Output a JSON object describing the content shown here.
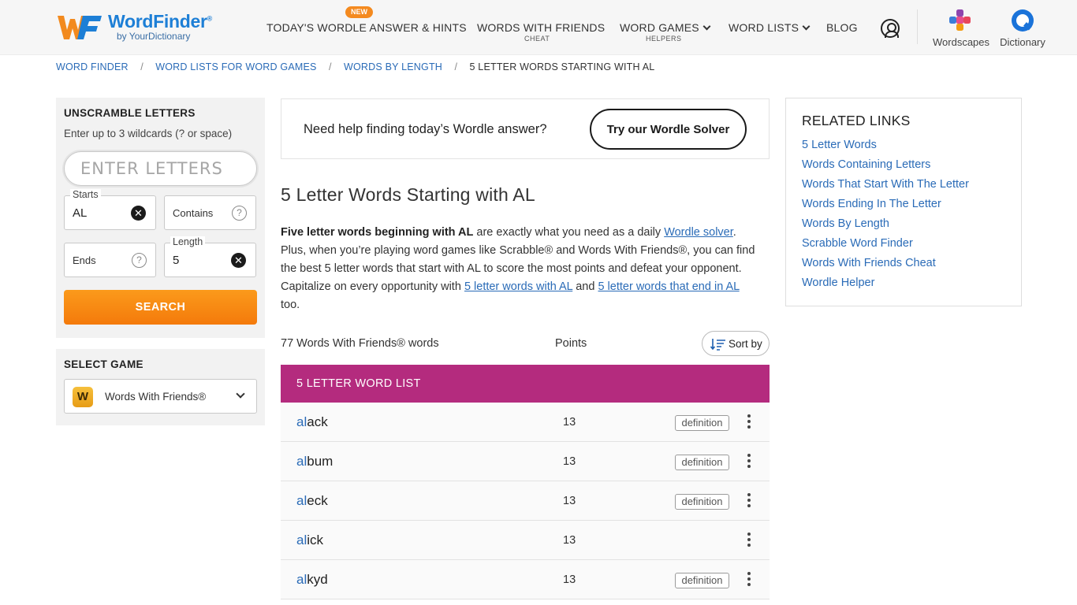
{
  "header": {
    "logo_name": "WordFinder",
    "logo_reg": "®",
    "logo_sub": "by YourDictionary",
    "nav": [
      {
        "label": "TODAY'S WORDLE ANSWER & HINTS",
        "badge": "NEW",
        "sub": ""
      },
      {
        "label": "WORDS WITH FRIENDS",
        "sub": "CHEAT"
      },
      {
        "label": "WORD GAMES",
        "sub": "HELPERS"
      },
      {
        "label": "WORD LISTS",
        "sub": ""
      },
      {
        "label": "BLOG",
        "sub": ""
      }
    ],
    "apps": [
      {
        "label": "Wordscapes",
        "icon": "wordscapes-icon"
      },
      {
        "label": "Dictionary",
        "icon": "dictionary-icon"
      }
    ]
  },
  "breadcrumb": [
    "WORD FINDER",
    "WORD LISTS FOR WORD GAMES",
    "WORDS BY LENGTH",
    "5 LETTER WORDS STARTING WITH AL"
  ],
  "unscramble": {
    "title": "UNSCRAMBLE LETTERS",
    "help": "Enter up to 3 wildcards (? or space)",
    "placeholder": "ENTER LETTERS",
    "starts_label": "Starts",
    "starts_value": "AL",
    "contains_label": "Contains",
    "ends_label": "Ends",
    "length_label": "Length",
    "length_value": "5",
    "search_label": "SEARCH"
  },
  "select_game": {
    "title": "SELECT GAME",
    "logo_letter": "W",
    "selected": "Words With Friends®"
  },
  "promo": {
    "text": "Need help finding today’s Wordle answer?",
    "button": "Try our Wordle Solver"
  },
  "main": {
    "title": "5 Letter Words Starting with AL",
    "intro": {
      "bold": "Five letter words beginning with AL",
      "t1": " are exactly what you need as a daily ",
      "link1": "Wordle solver",
      "t2": ". Plus, when you’re playing word games like Scrabble® and Words With Friends®, you can find the best 5 letter words that start with AL to score the most points and defeat your opponent. Capitalize on every opportunity with ",
      "link2": "5 letter words with AL",
      "t3": " and ",
      "link3": "5 letter words that end in AL",
      "t4": " too."
    },
    "count_label": "77 Words With Friends® words",
    "points_label": "Points",
    "sort_label": "Sort by",
    "list_header": "5 LETTER WORD LIST",
    "definition_label": "definition",
    "words": [
      {
        "prefix": "al",
        "rest": "ack",
        "points": "13",
        "definition": true
      },
      {
        "prefix": "al",
        "rest": "bum",
        "points": "13",
        "definition": true
      },
      {
        "prefix": "al",
        "rest": "eck",
        "points": "13",
        "definition": true
      },
      {
        "prefix": "al",
        "rest": "ick",
        "points": "13",
        "definition": false
      },
      {
        "prefix": "al",
        "rest": "kyd",
        "points": "13",
        "definition": true
      }
    ]
  },
  "related": {
    "title": "RELATED LINKS",
    "links": [
      "5 Letter Words",
      "Words Containing Letters",
      "Words That Start With The Letter",
      "Words Ending In The Letter",
      "Words By Length",
      "Scrabble Word Finder",
      "Words With Friends Cheat",
      "Wordle Helper"
    ]
  },
  "colors": {
    "brand_blue": "#1d7fd6",
    "link_blue": "#2a6bb7",
    "search_orange": "#f47a0b",
    "list_header_magenta": "#b42b7e"
  }
}
